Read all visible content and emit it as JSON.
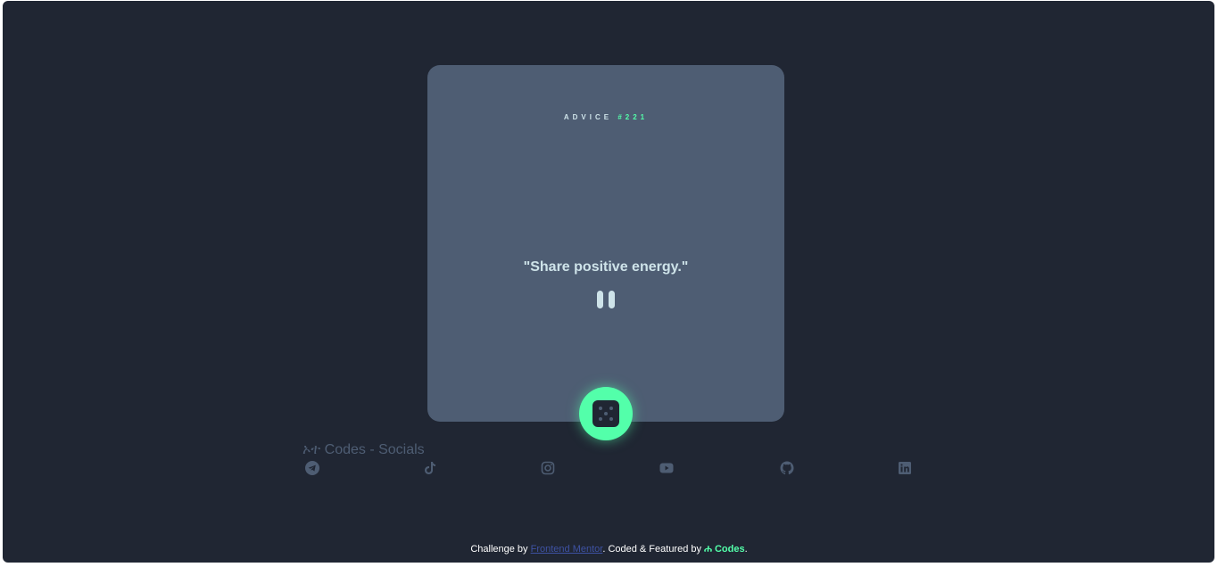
{
  "card": {
    "advice_label": "ADVICE",
    "advice_number": "#221",
    "quote": "\"Share positive energy.\""
  },
  "dice_button": {
    "icon": "dice-icon"
  },
  "socials": {
    "title": "ኦተ Codes - Socials",
    "icons": [
      "telegram-icon",
      "tiktok-icon",
      "instagram-icon",
      "youtube-icon",
      "github-icon",
      "linkedin-icon"
    ]
  },
  "footer": {
    "prefix": "Challenge by ",
    "link_text": "Frontend Mentor",
    "middle": ". Coded & Featured by ",
    "brand": "Codes",
    "suffix": "."
  },
  "colors": {
    "background": "#202633",
    "card": "#4e5d73",
    "accent": "#53ffaa",
    "text": "#cee3e9"
  }
}
